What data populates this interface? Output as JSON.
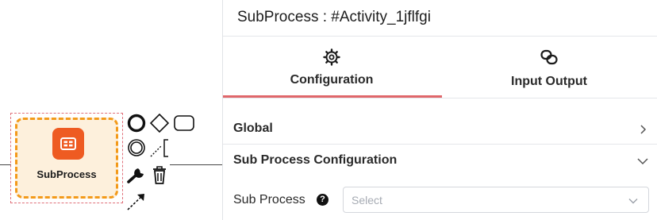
{
  "canvas": {
    "element": {
      "label": "SubProcess",
      "icon": "subprocess-icon",
      "fill_color": "#fdf0dc",
      "border_color": "#f39a1a",
      "icon_bg_color": "#ee5b22"
    },
    "context_pad": [
      "append-end-event-icon",
      "append-gateway-icon",
      "append-task-icon",
      "append-intermediate-event-icon",
      "text-annotation-icon",
      "change-type-wrench-icon",
      "delete-trash-icon",
      "connect-arrow-icon"
    ]
  },
  "panel": {
    "title": "SubProcess : #Activity_1jflfgi",
    "tabs": [
      {
        "label": "Configuration",
        "icon": "gear-icon",
        "active": true
      },
      {
        "label": "Input Output",
        "icon": "link-icon",
        "active": false
      }
    ],
    "accent_color": "#e0676b",
    "sections": [
      {
        "label": "Global",
        "expanded": false,
        "chevron": "chevron-right-icon"
      },
      {
        "label": "Sub Process Configuration",
        "expanded": true,
        "chevron": "chevron-down-icon"
      }
    ],
    "sub_process_field": {
      "label": "Sub Process",
      "help_glyph": "?",
      "placeholder": "Select"
    }
  }
}
